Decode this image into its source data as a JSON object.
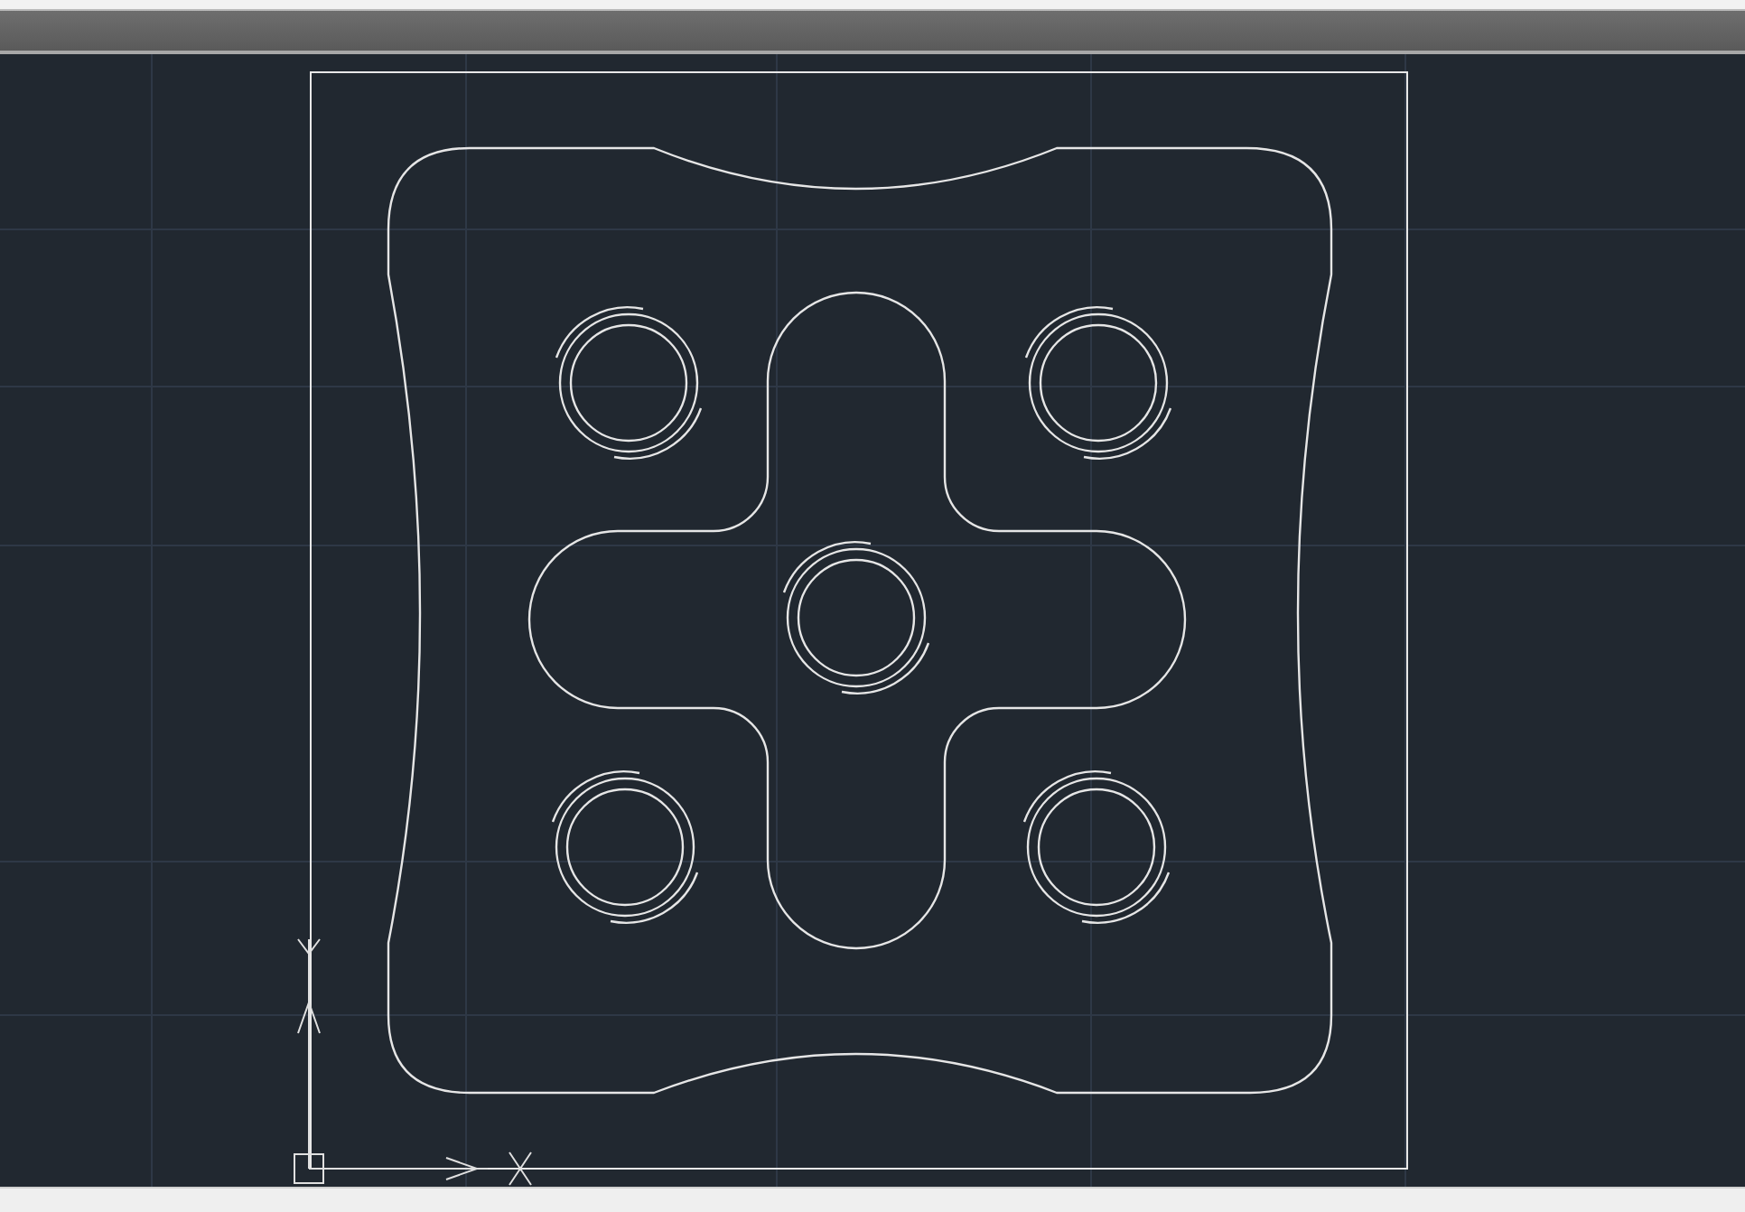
{
  "viewport": {
    "grid_visible": true,
    "ucs_icon_visible": true
  }
}
